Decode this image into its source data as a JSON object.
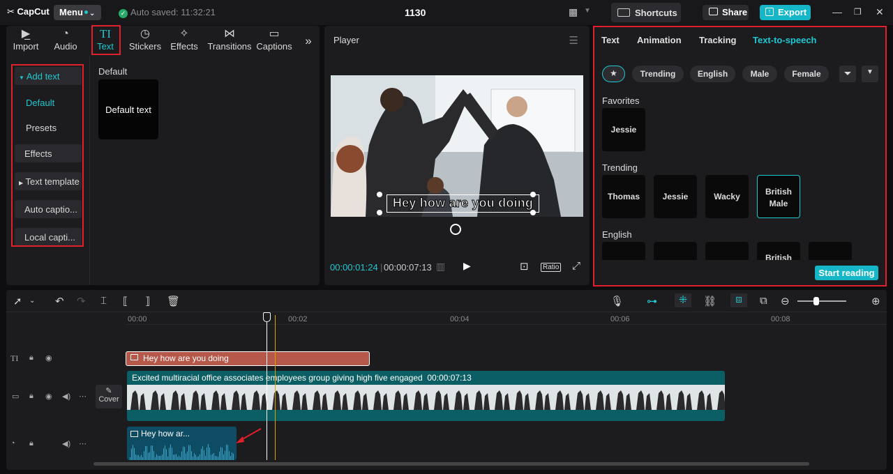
{
  "topbar": {
    "logo": "CapCut",
    "menu_label": "Menu",
    "autosave": "Auto saved: 11:32:21",
    "title": "1130",
    "shortcuts_label": "Shortcuts",
    "share_label": "Share",
    "export_label": "Export"
  },
  "toolbar": {
    "items": [
      {
        "label": "Import",
        "icon": "import-icon"
      },
      {
        "label": "Audio",
        "icon": "audio-icon"
      },
      {
        "label": "Text",
        "icon": "text-icon"
      },
      {
        "label": "Stickers",
        "icon": "stickers-icon"
      },
      {
        "label": "Effects",
        "icon": "effects-icon"
      },
      {
        "label": "Transitions",
        "icon": "transitions-icon"
      },
      {
        "label": "Captions",
        "icon": "captions-icon"
      }
    ],
    "active": "Text"
  },
  "sidebar": {
    "items": [
      {
        "label": "Add text"
      },
      {
        "label": "Default"
      },
      {
        "label": "Presets"
      },
      {
        "label": "Effects"
      },
      {
        "label": "Text template"
      },
      {
        "label": "Auto captio..."
      },
      {
        "label": "Local capti..."
      }
    ]
  },
  "content": {
    "section_label": "Default",
    "card_label": "Default text"
  },
  "player": {
    "title": "Player",
    "caption": "Hey how are you doing",
    "time_current": "00:00:01:24",
    "time_total": "00:00:07:13",
    "ratio_label": "Ratio"
  },
  "right_panel": {
    "tabs": [
      "Text",
      "Animation",
      "Tracking",
      "Text-to-speech"
    ],
    "active_tab": "Text-to-speech",
    "filters": [
      "Trending",
      "English",
      "Male",
      "Female"
    ],
    "sections": {
      "favorites": {
        "title": "Favorites",
        "voices": [
          "Jessie"
        ]
      },
      "trending": {
        "title": "Trending",
        "voices": [
          "Thomas",
          "Jessie",
          "Wacky",
          "British Male"
        ],
        "selected": "British Male"
      },
      "english": {
        "title": "English",
        "voices": [
          "",
          "",
          "",
          "British",
          ""
        ]
      }
    },
    "start_label": "Start reading"
  },
  "timeline": {
    "ruler": [
      "00:00",
      "00:02",
      "00:04",
      "00:06",
      "00:08"
    ],
    "text_clip": "Hey how are you doing",
    "video_clip_title": "Excited multiracial office associates employees group giving high five engaged",
    "video_clip_duration": "00:00:07:13",
    "audio_clip": "Hey how ar...",
    "cover_label": "Cover"
  },
  "colors": {
    "accent": "#1fc8d0",
    "highlight_box": "#e0202a",
    "text_clip": "#b5584a",
    "video_clip": "#0b5f64",
    "audio_clip": "#0e4c63"
  }
}
